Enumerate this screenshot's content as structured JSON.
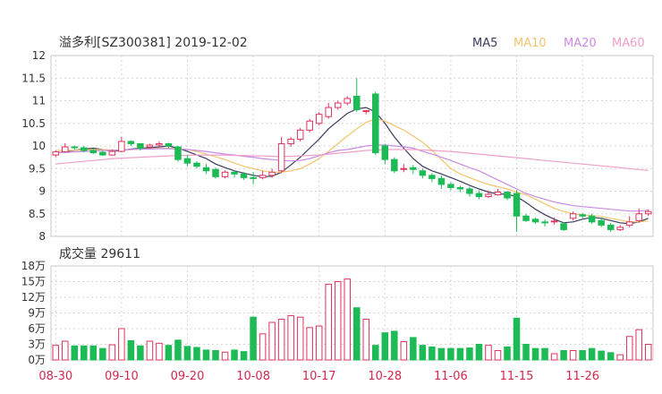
{
  "header": {
    "title": "溢多利[SZ300381] 2019-12-02",
    "legend": [
      {
        "label": "MA5",
        "color": "#3b3b5e"
      },
      {
        "label": "MA10",
        "color": "#f2c46d"
      },
      {
        "label": "MA20",
        "color": "#c98be3"
      },
      {
        "label": "MA60",
        "color": "#f0a0c8"
      }
    ]
  },
  "volume_header": {
    "label": "成交量 29611"
  },
  "colors": {
    "up": "#e0335e",
    "down": "#1dbb55"
  },
  "chart_data": [
    {
      "type": "candlestick",
      "title": "溢多利[SZ300381] 2019-12-02",
      "ylim": [
        8,
        12
      ],
      "yticks": [
        "12",
        "11.5",
        "11",
        "10.5",
        "10",
        "9.5",
        "9",
        "8.5",
        "8"
      ],
      "xticks": [
        {
          "label": "08-30",
          "index": 0
        },
        {
          "label": "09-10",
          "index": 7
        },
        {
          "label": "09-20",
          "index": 14
        },
        {
          "label": "10-08",
          "index": 21
        },
        {
          "label": "10-17",
          "index": 28
        },
        {
          "label": "10-28",
          "index": 35
        },
        {
          "label": "11-06",
          "index": 42
        },
        {
          "label": "11-15",
          "index": 49
        },
        {
          "label": "11-26",
          "index": 56
        }
      ],
      "series": [
        {
          "name": "candles",
          "values": [
            [
              9.8,
              9.87,
              9.75,
              9.9
            ],
            [
              9.87,
              9.98,
              9.85,
              10.06
            ],
            [
              9.98,
              9.96,
              9.92,
              10.01
            ],
            [
              9.96,
              9.9,
              9.86,
              10.0
            ],
            [
              9.9,
              9.85,
              9.82,
              9.93
            ],
            [
              9.86,
              9.8,
              9.78,
              9.9
            ],
            [
              9.8,
              9.88,
              9.78,
              9.92
            ],
            [
              9.88,
              10.1,
              9.86,
              10.2
            ],
            [
              10.1,
              10.05,
              10.0,
              10.12
            ],
            [
              10.05,
              9.95,
              9.9,
              10.05
            ],
            [
              9.98,
              10.02,
              9.94,
              10.05
            ],
            [
              10.02,
              10.05,
              9.98,
              10.1
            ],
            [
              10.05,
              10.0,
              9.95,
              10.07
            ],
            [
              9.98,
              9.7,
              9.65,
              10.0
            ],
            [
              9.72,
              9.62,
              9.55,
              9.8
            ],
            [
              9.62,
              9.55,
              9.5,
              9.66
            ],
            [
              9.52,
              9.45,
              9.38,
              9.6
            ],
            [
              9.48,
              9.32,
              9.28,
              9.52
            ],
            [
              9.32,
              9.42,
              9.28,
              9.46
            ],
            [
              9.42,
              9.38,
              9.3,
              9.45
            ],
            [
              9.38,
              9.3,
              9.25,
              9.42
            ],
            [
              9.3,
              9.28,
              9.15,
              9.42
            ],
            [
              9.3,
              9.35,
              9.26,
              9.45
            ],
            [
              9.35,
              9.42,
              9.3,
              9.5
            ],
            [
              9.45,
              10.05,
              9.4,
              10.2
            ],
            [
              10.05,
              10.15,
              9.98,
              10.2
            ],
            [
              10.15,
              10.35,
              10.1,
              10.4
            ],
            [
              10.35,
              10.55,
              10.3,
              10.6
            ],
            [
              10.5,
              10.7,
              10.45,
              10.75
            ],
            [
              10.65,
              10.85,
              10.6,
              10.95
            ],
            [
              10.85,
              10.95,
              10.8,
              11.0
            ],
            [
              10.95,
              11.05,
              10.9,
              11.1
            ],
            [
              11.1,
              10.8,
              10.75,
              11.5
            ],
            [
              10.78,
              10.78,
              10.7,
              10.8
            ],
            [
              11.15,
              9.85,
              9.8,
              11.2
            ],
            [
              10.0,
              9.7,
              9.6,
              10.05
            ],
            [
              9.7,
              9.45,
              9.4,
              9.75
            ],
            [
              9.48,
              9.5,
              9.42,
              9.6
            ],
            [
              9.52,
              9.48,
              9.38,
              9.58
            ],
            [
              9.45,
              9.35,
              9.28,
              9.5
            ],
            [
              9.35,
              9.28,
              9.2,
              9.4
            ],
            [
              9.28,
              9.15,
              9.05,
              9.35
            ],
            [
              9.15,
              9.08,
              9.02,
              9.2
            ],
            [
              9.08,
              9.05,
              8.98,
              9.12
            ],
            [
              9.05,
              8.95,
              8.88,
              9.1
            ],
            [
              8.95,
              8.88,
              8.82,
              9.02
            ],
            [
              8.88,
              8.93,
              8.85,
              9.02
            ],
            [
              8.92,
              8.98,
              8.9,
              9.05
            ],
            [
              8.98,
              8.85,
              8.8,
              9.0
            ],
            [
              8.95,
              8.45,
              8.1,
              9.02
            ],
            [
              8.45,
              8.35,
              8.32,
              8.5
            ],
            [
              8.38,
              8.32,
              8.28,
              8.42
            ],
            [
              8.32,
              8.3,
              8.22,
              8.38
            ],
            [
              8.32,
              8.34,
              8.26,
              8.42
            ],
            [
              8.28,
              8.15,
              8.12,
              8.32
            ],
            [
              8.4,
              8.5,
              8.35,
              8.55
            ],
            [
              8.48,
              8.45,
              8.4,
              8.52
            ],
            [
              8.45,
              8.32,
              8.28,
              8.5
            ],
            [
              8.35,
              8.25,
              8.2,
              8.42
            ],
            [
              8.25,
              8.15,
              8.1,
              8.3
            ],
            [
              8.15,
              8.2,
              8.12,
              8.25
            ],
            [
              8.25,
              8.32,
              8.2,
              8.45
            ],
            [
              8.35,
              8.5,
              8.3,
              8.62
            ],
            [
              8.5,
              8.55,
              8.45,
              8.6
            ]
          ]
        },
        {
          "name": "MA5",
          "values": [
            9.85,
            9.87,
            9.9,
            9.93,
            9.95,
            9.92,
            9.88,
            9.9,
            9.93,
            9.95,
            9.96,
            9.98,
            10.0,
            9.95,
            9.88,
            9.8,
            9.72,
            9.6,
            9.52,
            9.45,
            9.4,
            9.35,
            9.32,
            9.33,
            9.42,
            9.58,
            9.75,
            9.95,
            10.15,
            10.38,
            10.55,
            10.72,
            10.82,
            10.85,
            10.75,
            10.5,
            10.2,
            9.95,
            9.72,
            9.55,
            9.45,
            9.38,
            9.3,
            9.22,
            9.13,
            9.05,
            8.98,
            8.94,
            8.93,
            8.88,
            8.75,
            8.6,
            8.48,
            8.38,
            8.3,
            8.32,
            8.38,
            8.42,
            8.4,
            8.35,
            8.3,
            8.28,
            8.32,
            8.4
          ]
        },
        {
          "name": "MA10",
          "values": [
            9.9,
            9.9,
            9.9,
            9.91,
            9.92,
            9.92,
            9.91,
            9.91,
            9.92,
            9.93,
            9.94,
            9.95,
            9.95,
            9.94,
            9.92,
            9.88,
            9.82,
            9.76,
            9.7,
            9.62,
            9.55,
            9.5,
            9.45,
            9.42,
            9.42,
            9.45,
            9.5,
            9.6,
            9.72,
            9.88,
            10.05,
            10.22,
            10.38,
            10.52,
            10.6,
            10.55,
            10.45,
            10.35,
            10.22,
            10.08,
            9.9,
            9.7,
            9.5,
            9.38,
            9.3,
            9.22,
            9.15,
            9.1,
            9.05,
            8.98,
            8.92,
            8.82,
            8.72,
            8.62,
            8.55,
            8.5,
            8.48,
            8.46,
            8.44,
            8.4,
            8.36,
            8.32,
            8.32,
            8.34
          ]
        },
        {
          "name": "MA20",
          "values": [
            9.85,
            9.86,
            9.87,
            9.88,
            9.89,
            9.9,
            9.9,
            9.91,
            9.92,
            9.93,
            9.93,
            9.94,
            9.94,
            9.93,
            9.92,
            9.9,
            9.88,
            9.85,
            9.82,
            9.8,
            9.77,
            9.75,
            9.72,
            9.7,
            9.68,
            9.67,
            9.68,
            9.72,
            9.78,
            9.85,
            9.9,
            9.92,
            9.96,
            10.0,
            10.02,
            10.02,
            10.0,
            9.98,
            9.95,
            9.88,
            9.82,
            9.75,
            9.68,
            9.6,
            9.52,
            9.45,
            9.35,
            9.25,
            9.15,
            9.05,
            8.95,
            8.88,
            8.82,
            8.76,
            8.72,
            8.68,
            8.66,
            8.64,
            8.62,
            8.6,
            8.58,
            8.56,
            8.56,
            8.58
          ]
        },
        {
          "name": "MA60",
          "values": [
            9.6,
            9.62,
            9.64,
            9.66,
            9.68,
            9.7,
            9.72,
            9.73,
            9.74,
            9.75,
            9.76,
            9.77,
            9.78,
            9.79,
            9.79,
            9.8,
            9.8,
            9.8,
            9.8,
            9.79,
            9.79,
            9.78,
            9.78,
            9.77,
            9.77,
            9.77,
            9.78,
            9.79,
            9.8,
            9.82,
            9.84,
            9.86,
            9.88,
            9.9,
            9.91,
            9.92,
            9.92,
            9.92,
            9.92,
            9.91,
            9.9,
            9.89,
            9.88,
            9.86,
            9.84,
            9.82,
            9.8,
            9.78,
            9.76,
            9.74,
            9.72,
            9.7,
            9.68,
            9.66,
            9.64,
            9.62,
            9.6,
            9.58,
            9.56,
            9.54,
            9.52,
            9.5,
            9.48,
            9.46
          ]
        }
      ]
    },
    {
      "type": "bar",
      "title": "成交量 29611",
      "ylim": [
        0,
        180000
      ],
      "yticks": [
        {
          "label": "18万",
          "value": 180000
        },
        {
          "label": "15万",
          "value": 150000
        },
        {
          "label": "12万",
          "value": 120000
        },
        {
          "label": "9万",
          "value": 90000
        },
        {
          "label": "6万",
          "value": 60000
        },
        {
          "label": "3万",
          "value": 30000
        },
        {
          "label": "0万",
          "value": 0
        }
      ],
      "values": [
        28000,
        36000,
        27000,
        27000,
        27000,
        22000,
        29000,
        60000,
        37000,
        27000,
        36000,
        32000,
        28000,
        38000,
        26000,
        24000,
        19000,
        18000,
        15000,
        19000,
        16000,
        82000,
        50000,
        72000,
        78000,
        85000,
        82000,
        62000,
        65000,
        145000,
        150000,
        155000,
        100000,
        78000,
        28000,
        52000,
        55000,
        35000,
        43000,
        28000,
        25000,
        22000,
        22000,
        22000,
        23000,
        30000,
        28000,
        18000,
        25000,
        80000,
        30000,
        22000,
        22000,
        12000,
        18000,
        18000,
        18000,
        22000,
        17000,
        14000,
        10000,
        45000,
        58000,
        30000
      ]
    }
  ]
}
